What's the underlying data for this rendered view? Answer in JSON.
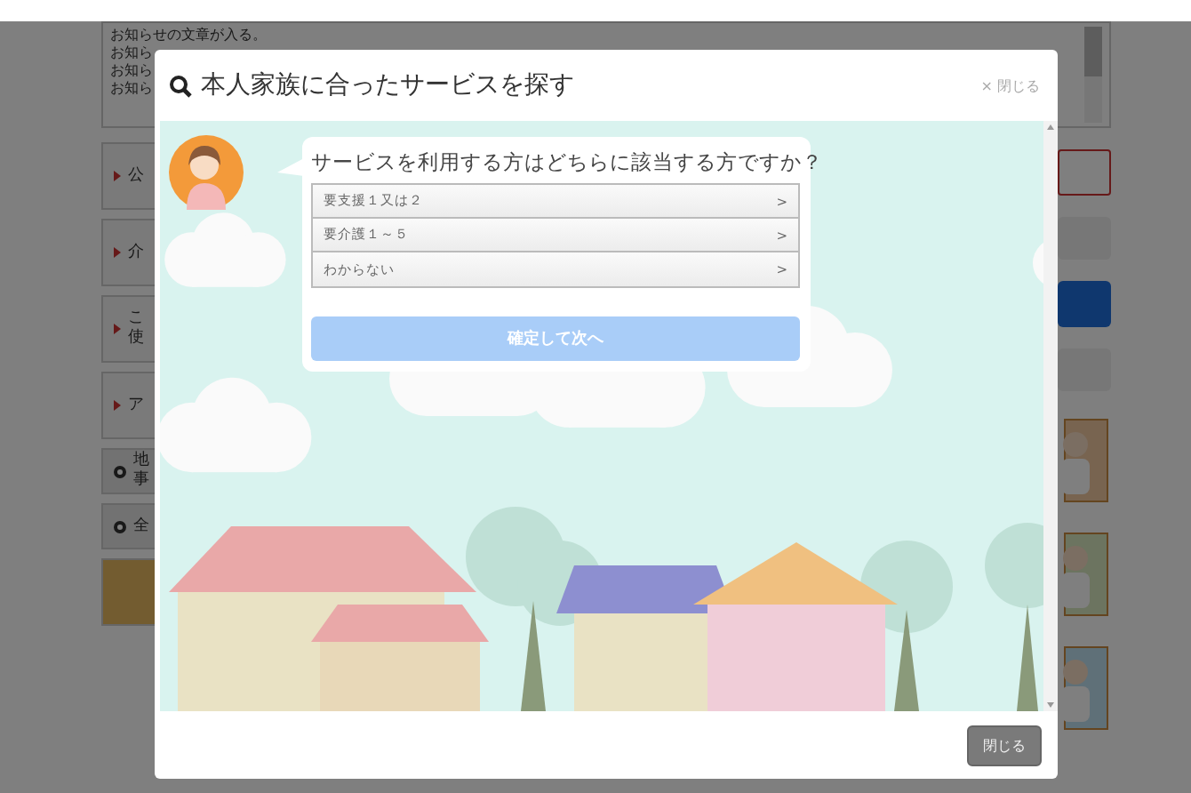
{
  "page": {
    "notice_lines": [
      "お知らせの文章が入る。",
      "お知ら",
      "お知ら",
      "お知ら"
    ],
    "side_items": [
      {
        "kind": "link",
        "lines": [
          "公"
        ]
      },
      {
        "kind": "link",
        "lines": [
          "介"
        ]
      },
      {
        "kind": "link",
        "lines": [
          "こ",
          "使"
        ]
      },
      {
        "kind": "link",
        "lines": [
          "ア"
        ]
      },
      {
        "kind": "small",
        "lines": [
          "地",
          "事"
        ]
      },
      {
        "kind": "small",
        "lines": [
          "全"
        ]
      },
      {
        "kind": "banner"
      }
    ]
  },
  "modal": {
    "title": "本人家族に合ったサービスを探す",
    "close_link": "× 閉じる",
    "question": "サービスを利用する方はどちらに該当する方ですか？",
    "options": [
      {
        "label": "要支援１又は２",
        "arrow": ">",
        "selected": false
      },
      {
        "label": "要介護１～５",
        "arrow": ">",
        "selected": false
      },
      {
        "label": "わからない",
        "arrow": ">",
        "selected": false
      }
    ],
    "confirm": {
      "label": "確定して次へ",
      "disabled": true
    },
    "footer_close": "閉じる"
  }
}
